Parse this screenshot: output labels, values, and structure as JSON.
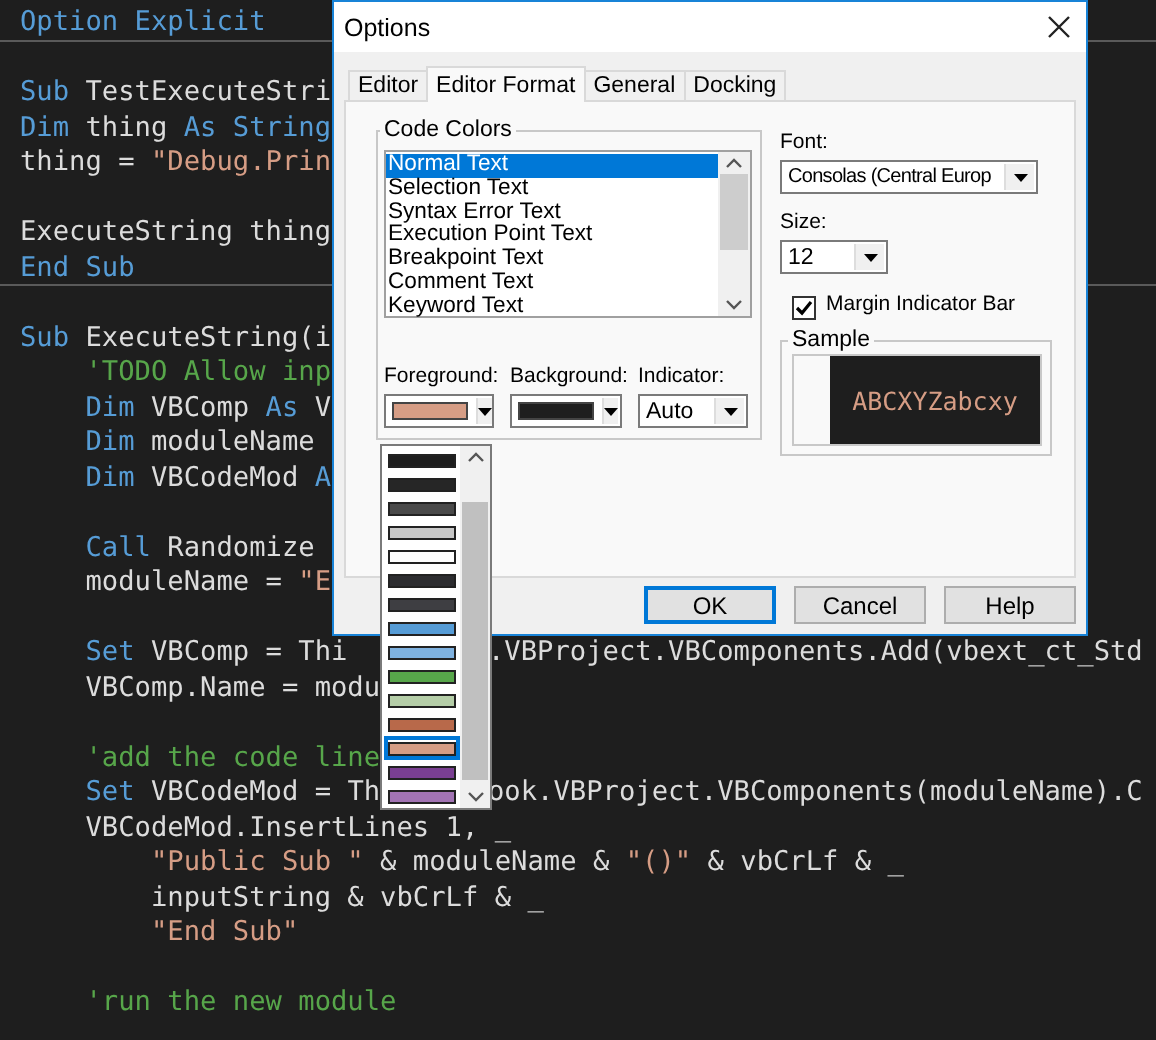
{
  "editor": {
    "lines": [
      {
        "kind": "code",
        "divider_below": true,
        "segments": [
          {
            "kind": "keyword",
            "text": "Option Explicit"
          }
        ]
      },
      {
        "kind": "blank"
      },
      {
        "kind": "code",
        "segments": [
          {
            "kind": "keyword",
            "text": "Sub"
          },
          {
            "kind": "plain",
            "text": " TestExecuteStri"
          }
        ]
      },
      {
        "kind": "code",
        "segments": [
          {
            "kind": "keyword",
            "text": "Dim"
          },
          {
            "kind": "plain",
            "text": " thing "
          },
          {
            "kind": "keyword",
            "text": "As String"
          }
        ]
      },
      {
        "kind": "code",
        "segments": [
          {
            "kind": "plain",
            "text": "thing = "
          },
          {
            "kind": "string",
            "text": "\"Debug.Prin"
          }
        ]
      },
      {
        "kind": "blank"
      },
      {
        "kind": "code",
        "segments": [
          {
            "kind": "plain",
            "text": "ExecuteString thing"
          }
        ]
      },
      {
        "kind": "code",
        "divider_below": true,
        "segments": [
          {
            "kind": "keyword",
            "text": "End Sub"
          }
        ]
      },
      {
        "kind": "blank"
      },
      {
        "kind": "code",
        "segments": [
          {
            "kind": "keyword",
            "text": "Sub"
          },
          {
            "kind": "plain",
            "text": " ExecuteString(i"
          }
        ]
      },
      {
        "kind": "code",
        "segments": [
          {
            "kind": "comment",
            "text": "    'TODO Allow inp"
          }
        ]
      },
      {
        "kind": "code",
        "segments": [
          {
            "kind": "keyword",
            "text": "    Dim"
          },
          {
            "kind": "plain",
            "text": " VBComp "
          },
          {
            "kind": "keyword",
            "text": "As"
          },
          {
            "kind": "plain",
            "text": " V"
          }
        ]
      },
      {
        "kind": "code",
        "segments": [
          {
            "kind": "keyword",
            "text": "    Dim"
          },
          {
            "kind": "plain",
            "text": " moduleName"
          }
        ]
      },
      {
        "kind": "code",
        "segments": [
          {
            "kind": "keyword",
            "text": "    Dim"
          },
          {
            "kind": "plain",
            "text": " VBCodeMod "
          },
          {
            "kind": "keyword",
            "text": "A"
          }
        ]
      },
      {
        "kind": "blank"
      },
      {
        "kind": "code",
        "segments": [
          {
            "kind": "keyword",
            "text": "    Call"
          },
          {
            "kind": "plain",
            "text": " Randomize"
          }
        ]
      },
      {
        "kind": "code",
        "segments": [
          {
            "kind": "plain",
            "text": "    moduleName = "
          },
          {
            "kind": "string",
            "text": "\"E"
          }
        ]
      },
      {
        "kind": "blank"
      },
      {
        "kind": "code",
        "segments": [
          {
            "kind": "keyword",
            "text": "    Set"
          },
          {
            "kind": "plain",
            "text": " VBComp = Thi"
          }
        ],
        "tail": ".VBProject.VBComponents.Add(vbext_ct_Std"
      },
      {
        "kind": "code",
        "segments": [
          {
            "kind": "plain",
            "text": "    VBComp.Name = modu"
          }
        ]
      },
      {
        "kind": "blank"
      },
      {
        "kind": "code",
        "segments": [
          {
            "kind": "comment",
            "text": "    'add the code line"
          }
        ]
      },
      {
        "kind": "code",
        "segments": [
          {
            "kind": "keyword",
            "text": "    Set"
          },
          {
            "kind": "plain",
            "text": " VBCodeMod = Th"
          }
        ],
        "tail": "ook.VBProject.VBComponents(moduleName).C"
      },
      {
        "kind": "code",
        "segments": [
          {
            "kind": "plain",
            "text": "    VBCodeMod.InsertLines 1, _"
          }
        ]
      },
      {
        "kind": "code",
        "segments": [
          {
            "kind": "string",
            "text": "        \"Public Sub \""
          },
          {
            "kind": "plain",
            "text": " & moduleName & "
          },
          {
            "kind": "string",
            "text": "\"()\""
          },
          {
            "kind": "plain",
            "text": " & vbCrLf & _"
          }
        ]
      },
      {
        "kind": "code",
        "segments": [
          {
            "kind": "plain",
            "text": "        inputString & vbCrLf & _"
          }
        ]
      },
      {
        "kind": "code",
        "segments": [
          {
            "kind": "string",
            "text": "        \"End Sub\""
          }
        ]
      },
      {
        "kind": "blank"
      },
      {
        "kind": "code",
        "segments": [
          {
            "kind": "comment",
            "text": "    'run the new module"
          }
        ]
      }
    ]
  },
  "dialog": {
    "title": "Options",
    "tabs": [
      {
        "label": "Editor",
        "selected": false
      },
      {
        "label": "Editor Format",
        "selected": true
      },
      {
        "label": "General",
        "selected": false
      },
      {
        "label": "Docking",
        "selected": false
      }
    ],
    "code_colors": {
      "label": "Code Colors",
      "items": [
        {
          "label": "Normal Text",
          "selected": true
        },
        {
          "label": "Selection Text",
          "selected": false
        },
        {
          "label": "Syntax Error Text",
          "selected": false
        },
        {
          "label": "Execution Point Text",
          "selected": false
        },
        {
          "label": "Breakpoint Text",
          "selected": false
        },
        {
          "label": "Comment Text",
          "selected": false
        },
        {
          "label": "Keyword Text",
          "selected": false
        }
      ],
      "foreground": {
        "label": "Foreground:",
        "color": "#d69d85"
      },
      "background": {
        "label": "Background:",
        "color": "#1e1e1e"
      },
      "indicator": {
        "label": "Indicator:",
        "value": "Auto"
      }
    },
    "font": {
      "label": "Font:",
      "value": "Consolas (Central Europ"
    },
    "size": {
      "label": "Size:",
      "value": "12"
    },
    "margin_indicator_bar": {
      "label": "Margin Indicator Bar",
      "checked": true
    },
    "sample": {
      "label": "Sample",
      "text": "ABCXYZabcxy"
    },
    "buttons": [
      {
        "label": "OK",
        "default": true
      },
      {
        "label": "Cancel",
        "default": false
      },
      {
        "label": "Help",
        "default": false
      }
    ]
  },
  "color_dropdown": {
    "items": [
      {
        "color": "#1e1e1e",
        "selected": false
      },
      {
        "color": "#262626",
        "selected": false
      },
      {
        "color": "#4a4a4a",
        "selected": false
      },
      {
        "color": "#c8c8c8",
        "selected": false
      },
      {
        "color": "#ffffff",
        "selected": false
      },
      {
        "color": "#2d2d30",
        "selected": false
      },
      {
        "color": "#3e3e42",
        "selected": false
      },
      {
        "color": "#569cd6",
        "selected": false
      },
      {
        "color": "#7fb2e0",
        "selected": false
      },
      {
        "color": "#57a64a",
        "selected": false
      },
      {
        "color": "#b5cea8",
        "selected": false
      },
      {
        "color": "#b8694a",
        "selected": false
      },
      {
        "color": "#d69d85",
        "selected": true
      },
      {
        "color": "#7a3f92",
        "selected": false
      },
      {
        "color": "#a274b4",
        "selected": false
      }
    ]
  }
}
